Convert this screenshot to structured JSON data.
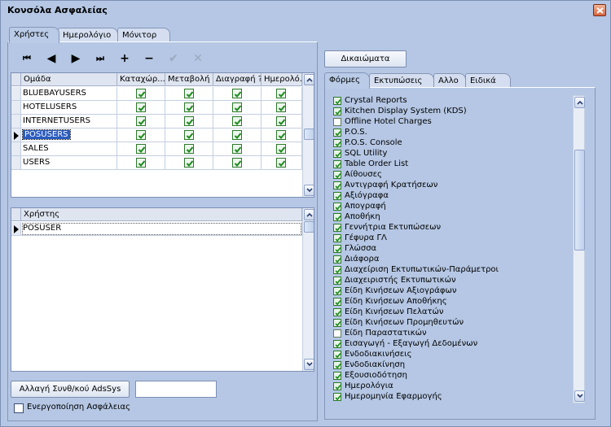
{
  "window": {
    "title": "Κονσόλα Ασφαλείας"
  },
  "main_tabs": [
    {
      "label": "Χρήστες",
      "active": true
    },
    {
      "label": "Ημερολόγιο",
      "active": false
    },
    {
      "label": "Μόνιτορ",
      "active": false
    }
  ],
  "navigator": [
    {
      "name": "first-icon",
      "glyph": "⏮",
      "enabled": true
    },
    {
      "name": "prior-icon",
      "glyph": "◀",
      "enabled": true
    },
    {
      "name": "next-icon",
      "glyph": "▶",
      "enabled": true
    },
    {
      "name": "last-icon",
      "glyph": "⏭",
      "enabled": true
    },
    {
      "name": "insert-icon",
      "glyph": "+",
      "enabled": true
    },
    {
      "name": "delete-icon",
      "glyph": "−",
      "enabled": true
    },
    {
      "name": "post-icon",
      "glyph": "✔",
      "enabled": false
    },
    {
      "name": "cancel-icon",
      "glyph": "✕",
      "enabled": false
    }
  ],
  "groups_grid": {
    "columns": [
      "Ομάδα",
      "Καταχώρ...",
      "Μεταβολή ?",
      "Διαγραφή ?",
      "Ημερολό..."
    ],
    "rows": [
      {
        "name": "BLUEBAYUSERS",
        "insert": true,
        "modify": true,
        "delete": true,
        "log": true,
        "current": false
      },
      {
        "name": "HOTELUSERS",
        "insert": true,
        "modify": true,
        "delete": true,
        "log": true,
        "current": false
      },
      {
        "name": "INTERNETUSERS",
        "insert": true,
        "modify": true,
        "delete": true,
        "log": true,
        "current": false
      },
      {
        "name": "POSUSERS",
        "insert": true,
        "modify": true,
        "delete": true,
        "log": true,
        "current": true
      },
      {
        "name": "SALES",
        "insert": true,
        "modify": true,
        "delete": true,
        "log": true,
        "current": false
      },
      {
        "name": "USERS",
        "insert": true,
        "modify": true,
        "delete": true,
        "log": true,
        "current": false
      }
    ]
  },
  "users_grid": {
    "columns": [
      "Χρήστης"
    ],
    "rows": [
      {
        "name": "POSUSER",
        "current": true
      }
    ]
  },
  "buttons": {
    "change_password": "Αλλαγή Συνθ/κού AdsSys",
    "rights": "Δικαιώματα"
  },
  "password_input": {
    "value": ""
  },
  "security_checkbox": {
    "label": "Ενεργοποίηση Ασφάλειας",
    "checked": false
  },
  "right_tabs": [
    {
      "label": "Φόρμες",
      "active": true
    },
    {
      "label": "Εκτυπώσεις",
      "active": false
    },
    {
      "label": "Αλλο",
      "active": false
    },
    {
      "label": "Ειδικά",
      "active": false
    }
  ],
  "forms_list": [
    {
      "label": "Crystal Reports",
      "checked": true
    },
    {
      "label": "Kitchen Display System (KDS)",
      "checked": true
    },
    {
      "label": "Offline Hotel Charges",
      "checked": false
    },
    {
      "label": "P.O.S.",
      "checked": true
    },
    {
      "label": "P.O.S. Console",
      "checked": true
    },
    {
      "label": "SQL Utility",
      "checked": true
    },
    {
      "label": "Table Order List",
      "checked": true
    },
    {
      "label": "Αίθουσες",
      "checked": true
    },
    {
      "label": "Αντιγραφή Κρατήσεων",
      "checked": true
    },
    {
      "label": "Αξιόγραφα",
      "checked": true
    },
    {
      "label": "Απογραφή",
      "checked": true
    },
    {
      "label": "Αποθήκη",
      "checked": true
    },
    {
      "label": "Γεννήτρια Εκτυπώσεων",
      "checked": true
    },
    {
      "label": "Γέφυρα ΓΛ",
      "checked": true
    },
    {
      "label": "Γλώσσα",
      "checked": true
    },
    {
      "label": "Διάφορα",
      "checked": true
    },
    {
      "label": "Διαχείριση Εκτυπωτικών-Παράμετροι",
      "checked": true
    },
    {
      "label": "Διαχειριστής Εκτυπωτικών",
      "checked": true
    },
    {
      "label": "Είδη Κινήσεων Αξιογράφων",
      "checked": true
    },
    {
      "label": "Είδη Κινήσεων Αποθήκης",
      "checked": true
    },
    {
      "label": "Είδη Κινήσεων Πελατών",
      "checked": true
    },
    {
      "label": "Είδη Κινήσεων Προμηθευτών",
      "checked": true
    },
    {
      "label": "Είδη Παραστατικών",
      "checked": false
    },
    {
      "label": "Εισαγωγή - Εξαγωγή Δεδομένων",
      "checked": true
    },
    {
      "label": "Ενδοδιακινήσεις",
      "checked": true
    },
    {
      "label": "Ενδοδιακίνηση",
      "checked": true
    },
    {
      "label": "Εξουσιοδότηση",
      "checked": true
    },
    {
      "label": "Ημερολόγια",
      "checked": true
    },
    {
      "label": "Ημερομηνία Εφαρμογής",
      "checked": true
    }
  ],
  "colors": {
    "window_bg": "#b5c7e4",
    "check_green": "#1d8a1d",
    "selection": "#2a5bbf"
  }
}
